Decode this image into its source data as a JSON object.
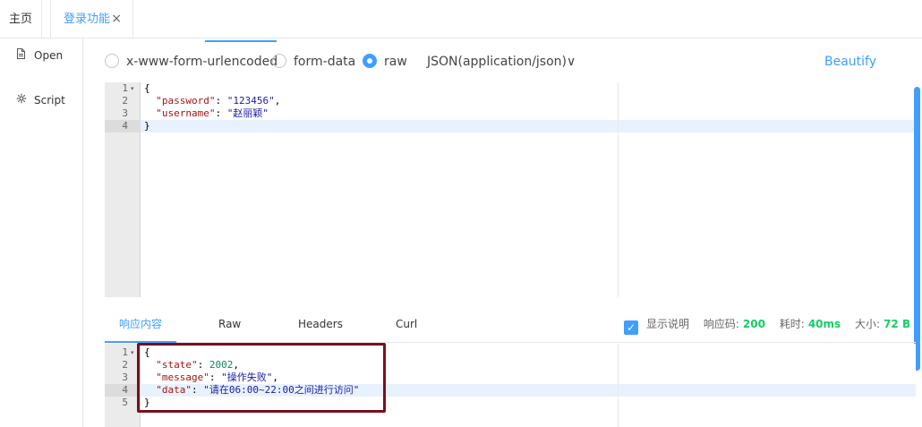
{
  "tabs": {
    "home": "主页",
    "login": "登录功能",
    "close": "×"
  },
  "sidebar": {
    "items": [
      {
        "label": "Open",
        "icon": "file-icon"
      },
      {
        "label": "Script",
        "icon": "script-icon"
      }
    ]
  },
  "body_types": {
    "options": [
      "x-www-form-urlencoded",
      "form-data",
      "raw"
    ],
    "selected": "raw",
    "content_type": "JSON(application/json)",
    "content_type_arrow": "∨",
    "beautify": "Beautify"
  },
  "request_editor": {
    "line_numbers": [
      "1",
      "2",
      "3",
      "4"
    ],
    "fold_marker": "▾",
    "lines": [
      {
        "indent": "",
        "open": "{"
      },
      {
        "indent": "  ",
        "key": "\"password\"",
        "sep": ": ",
        "value": "\"123456\"",
        "trail": ","
      },
      {
        "indent": "  ",
        "key": "\"username\"",
        "sep": ": ",
        "value": "\"赵丽颖\"",
        "trail": ""
      },
      {
        "indent": "",
        "open": "}"
      }
    ]
  },
  "response_tabs": {
    "items": [
      "响应内容",
      "Raw",
      "Headers",
      "Curl"
    ],
    "active": "响应内容"
  },
  "response_meta": {
    "show_desc": "显示说明",
    "check_mark": "✓",
    "code_label": "响应码:",
    "code_value": "200",
    "time_label": "耗时:",
    "time_value": "40ms",
    "size_label": "大小:",
    "size_value": "72 B"
  },
  "response_editor": {
    "line_numbers": [
      "1",
      "2",
      "3",
      "4",
      "5"
    ],
    "fold_marker": "▾",
    "lines": [
      {
        "indent": "",
        "open": "{"
      },
      {
        "indent": "  ",
        "key": "\"state\"",
        "sep": ": ",
        "value": "2002",
        "trail": ","
      },
      {
        "indent": "  ",
        "key": "\"message\"",
        "sep": ": ",
        "value": "\"操作失败\"",
        "trail": ","
      },
      {
        "indent": "  ",
        "key": "\"data\"",
        "sep": ": ",
        "value": "\"请在06:00~22:00之间进行访问\"",
        "trail": ""
      },
      {
        "indent": "",
        "open": "}"
      }
    ]
  },
  "colors": {
    "accent": "#409eff",
    "success": "#13ce66",
    "annotation": "#7a0f1c",
    "json_key": "#a31515",
    "json_string": "#1a1aa6",
    "json_number": "#098658"
  }
}
